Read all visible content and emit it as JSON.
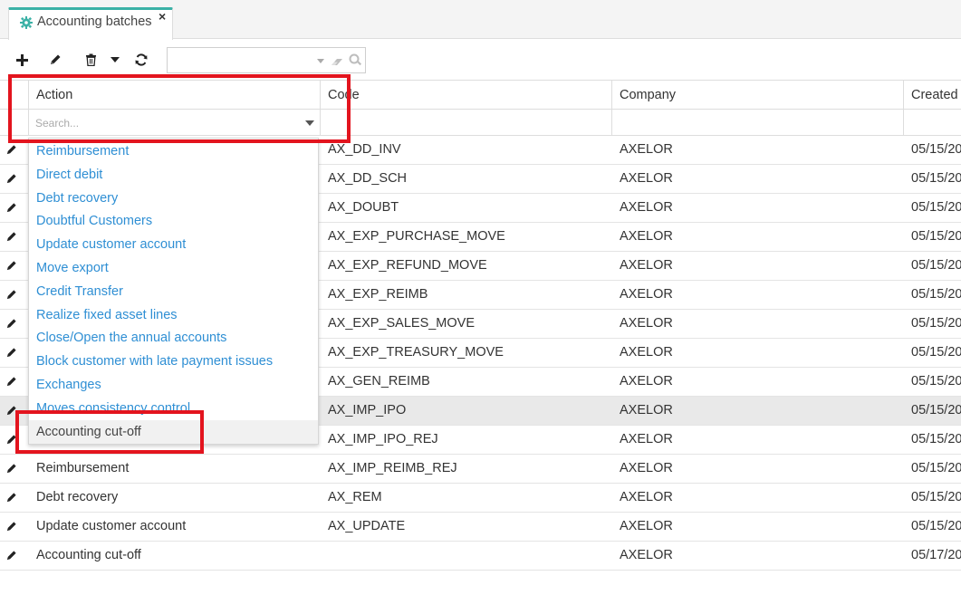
{
  "tab": {
    "title": "Accounting batches",
    "icon": "gear-icon",
    "close": "×"
  },
  "toolbar": {
    "buttons": [
      "plus-icon",
      "pencil-icon",
      "trash-icon",
      "caret-down-icon",
      "refresh-icon"
    ],
    "search": {
      "value": "",
      "placeholder": ""
    }
  },
  "grid": {
    "columns": [
      "Action",
      "Code",
      "Company",
      "Created"
    ],
    "action_filter_placeholder": "Search...",
    "rows": [
      {
        "action": "",
        "code": "AX_DD_INV",
        "company": "AXELOR",
        "created": "05/15/20"
      },
      {
        "action": "",
        "code": "AX_DD_SCH",
        "company": "AXELOR",
        "created": "05/15/20"
      },
      {
        "action": "",
        "code": "AX_DOUBT",
        "company": "AXELOR",
        "created": "05/15/20"
      },
      {
        "action": "",
        "code": "AX_EXP_PURCHASE_MOVE",
        "company": "AXELOR",
        "created": "05/15/20"
      },
      {
        "action": "",
        "code": "AX_EXP_REFUND_MOVE",
        "company": "AXELOR",
        "created": "05/15/20"
      },
      {
        "action": "",
        "code": "AX_EXP_REIMB",
        "company": "AXELOR",
        "created": "05/15/20"
      },
      {
        "action": "",
        "code": "AX_EXP_SALES_MOVE",
        "company": "AXELOR",
        "created": "05/15/20"
      },
      {
        "action": "",
        "code": "AX_EXP_TREASURY_MOVE",
        "company": "AXELOR",
        "created": "05/15/20"
      },
      {
        "action": "",
        "code": "AX_GEN_REIMB",
        "company": "AXELOR",
        "created": "05/15/20"
      },
      {
        "action": "",
        "code": "AX_IMP_IPO",
        "company": "AXELOR",
        "created": "05/15/20"
      },
      {
        "action": "",
        "code": "AX_IMP_IPO_REJ",
        "company": "AXELOR",
        "created": "05/15/20"
      },
      {
        "action": "Reimbursement",
        "code": "AX_IMP_REIMB_REJ",
        "company": "AXELOR",
        "created": "05/15/20"
      },
      {
        "action": "Debt recovery",
        "code": "AX_REM",
        "company": "AXELOR",
        "created": "05/15/20"
      },
      {
        "action": "Update customer account",
        "code": "AX_UPDATE",
        "company": "AXELOR",
        "created": "05/15/20"
      },
      {
        "action": "Accounting cut-off",
        "code": "",
        "company": "AXELOR",
        "created": "05/17/20"
      }
    ]
  },
  "dropdown": {
    "options": [
      "Reimbursement",
      "Direct debit",
      "Debt recovery",
      "Doubtful Customers",
      "Update customer account",
      "Move export",
      "Credit Transfer",
      "Realize fixed asset lines",
      "Close/Open the annual accounts",
      "Block customer with late payment issues",
      "Exchanges",
      "Moves consistency control",
      "Accounting cut-off"
    ],
    "active_index": 12
  },
  "colors": {
    "accent": "#3bb1a6",
    "link": "#2f8fd4",
    "highlight_box": "#e3141e",
    "row_highlight": "#e9e9e9"
  }
}
